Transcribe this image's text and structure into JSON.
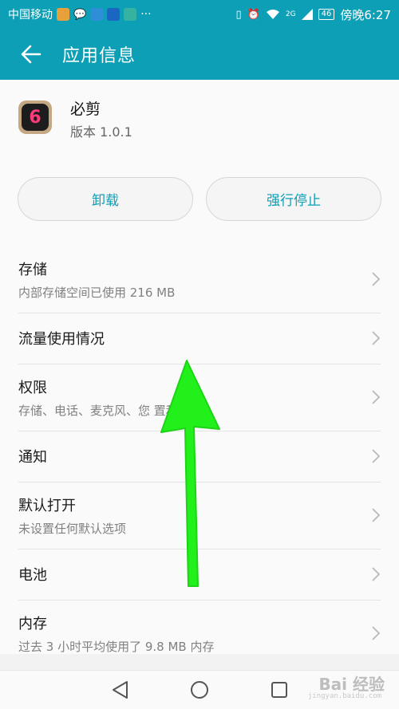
{
  "statusbar": {
    "carrier": "中国移动",
    "time": "傍晚6:27",
    "battery": "46",
    "network": "2G"
  },
  "appbar": {
    "title": "应用信息"
  },
  "app": {
    "name": "必剪",
    "version": "版本 1.0.1"
  },
  "buttons": {
    "uninstall": "卸载",
    "force_stop": "强行停止"
  },
  "rows": [
    {
      "title": "存储",
      "subtitle": "内部存储空间已使用 216 MB"
    },
    {
      "title": "流量使用情况"
    },
    {
      "title": "权限",
      "subtitle": "存储、电话、麦克风、您   置和相机"
    },
    {
      "title": "通知"
    },
    {
      "title": "默认打开",
      "subtitle": "未设置任何默认选项"
    },
    {
      "title": "电池"
    },
    {
      "title": "内存",
      "subtitle": "过去 3 小时平均使用了 9.8 MB 内存"
    }
  ],
  "watermark": {
    "text": "Bai 经验",
    "sub": "jingyan.baidu.com"
  },
  "colors": {
    "accent": "#0c9fb5",
    "arrow": "#22f01a"
  }
}
